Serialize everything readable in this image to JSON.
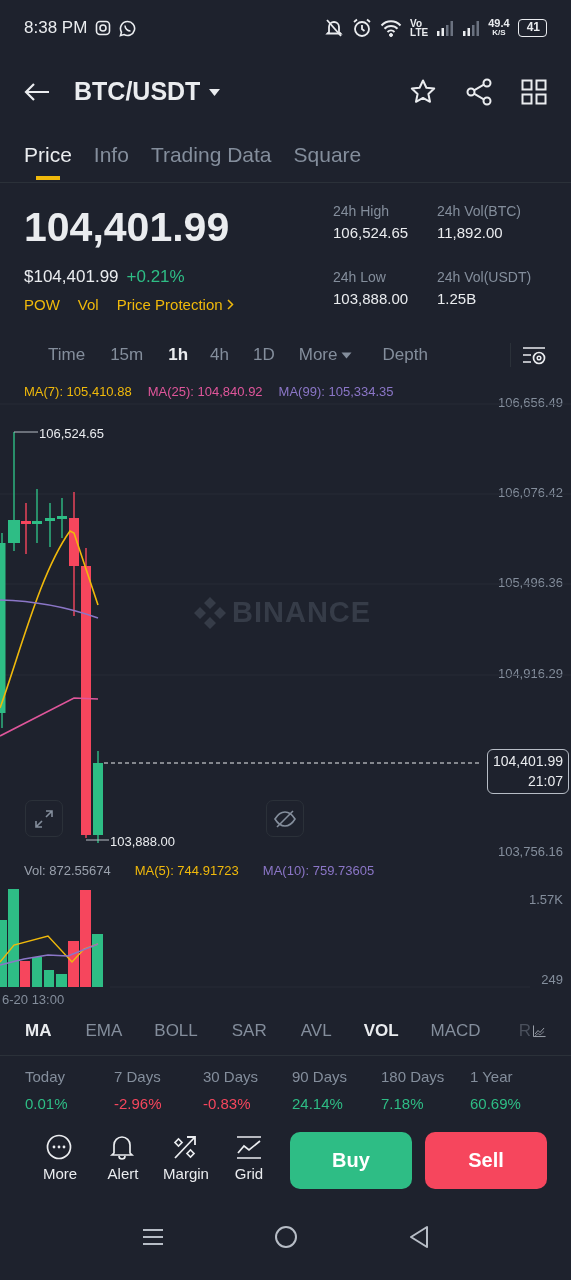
{
  "status_bar": {
    "time": "8:38 PM",
    "vo": "Vo",
    "lte": "LTE",
    "speed": "49.4",
    "speed_unit": "K/S",
    "battery": "41"
  },
  "header": {
    "pair": "BTC/USDT"
  },
  "tabs": [
    {
      "label": "Price",
      "selected": true
    },
    {
      "label": "Info",
      "selected": false
    },
    {
      "label": "Trading Data",
      "selected": false
    },
    {
      "label": "Square",
      "selected": false
    }
  ],
  "price": {
    "last": "104,401.99",
    "usd": "$104,401.99",
    "change": "+0.21%",
    "tags": [
      "POW",
      "Vol",
      "Price Protection"
    ]
  },
  "stats": [
    {
      "label": "24h High",
      "value": "106,524.65"
    },
    {
      "label": "24h Vol(BTC)",
      "value": "11,892.00"
    },
    {
      "label": "24h Low",
      "value": "103,888.00"
    },
    {
      "label": "24h Vol(USDT)",
      "value": "1.25B"
    }
  ],
  "intervals": [
    {
      "label": "Time",
      "selected": false,
      "kind": "plain"
    },
    {
      "label": "15m",
      "selected": false,
      "kind": "plain"
    },
    {
      "label": "1h",
      "selected": true,
      "kind": "plain"
    },
    {
      "label": "4h",
      "selected": false,
      "kind": "plain"
    },
    {
      "label": "1D",
      "selected": false,
      "kind": "plain"
    },
    {
      "label": "More",
      "selected": false,
      "kind": "dropdown"
    },
    {
      "label": "Depth",
      "selected": false,
      "kind": "plain"
    }
  ],
  "ma_legend": [
    {
      "label": "MA(7): 105,410.88",
      "color": "#f0b90b"
    },
    {
      "label": "MA(25): 104,840.92",
      "color": "#e0569b"
    },
    {
      "label": "MA(99): 105,334.35",
      "color": "#8b76c7"
    }
  ],
  "chart": {
    "watermark": "BINANCE",
    "high_label": "106,524.65",
    "low_label": "103,888.00",
    "y_labels": [
      "106,656.49",
      "106,076.42",
      "105,496.36",
      "104,916.29",
      "103,756.16"
    ],
    "current_price": "104,401.99",
    "countdown": "21:07"
  },
  "volume": {
    "legend": [
      {
        "label": "Vol: 872.55674",
        "color": "#9aa1ad"
      },
      {
        "label": "MA(5): 744.91723",
        "color": "#f0b90b"
      },
      {
        "label": "MA(10): 759.73605",
        "color": "#8b76c7"
      }
    ],
    "y_labels": [
      "1.57K",
      "249"
    ],
    "date_label": "6-20 13:00"
  },
  "indicators": [
    {
      "label": "MA",
      "selected": true
    },
    {
      "label": "EMA",
      "selected": false
    },
    {
      "label": "BOLL",
      "selected": false
    },
    {
      "label": "SAR",
      "selected": false
    },
    {
      "label": "AVL",
      "selected": false
    },
    {
      "label": "VOL",
      "selected": true
    },
    {
      "label": "MACD",
      "selected": false
    },
    {
      "label": "R",
      "selected": false
    }
  ],
  "performance": [
    {
      "period": "Today",
      "change": "0.01%",
      "color": "#2ebd85"
    },
    {
      "period": "7 Days",
      "change": "-2.96%",
      "color": "#f6465d"
    },
    {
      "period": "30 Days",
      "change": "-0.83%",
      "color": "#f6465d"
    },
    {
      "period": "90 Days",
      "change": "24.14%",
      "color": "#2ebd85"
    },
    {
      "period": "180 Days",
      "change": "7.18%",
      "color": "#2ebd85"
    },
    {
      "period": "1 Year",
      "change": "60.69%",
      "color": "#2ebd85"
    }
  ],
  "actions": [
    {
      "label": "More",
      "kind": "more"
    },
    {
      "label": "Alert",
      "kind": "alert"
    },
    {
      "label": "Margin",
      "kind": "margin"
    },
    {
      "label": "Grid",
      "kind": "grid"
    }
  ],
  "trade_buttons": [
    {
      "label": "Buy",
      "kind": "buy"
    },
    {
      "label": "Sell",
      "kind": "sell"
    }
  ]
}
